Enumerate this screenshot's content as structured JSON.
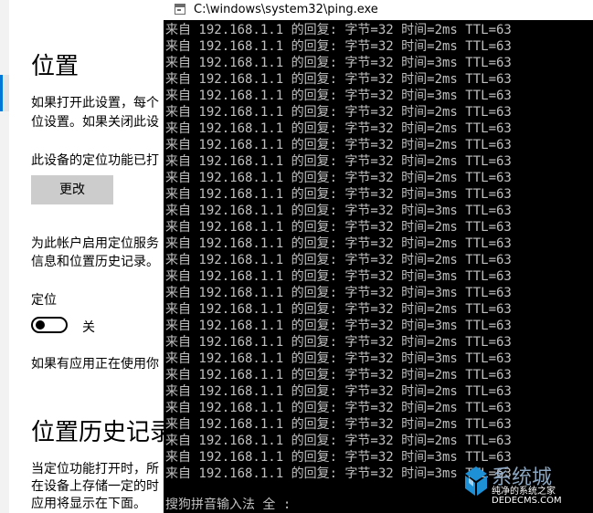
{
  "settings": {
    "title": "位置",
    "intro_line1": "如果打开此设置，每个",
    "intro_line2": "位设置。如果关闭此设",
    "device_status": "此设备的定位功能已打",
    "change_button": "更改",
    "account_line1": "为此帐户启用定位服务",
    "account_line2": "信息和位置历史记录。",
    "location_label": "定位",
    "toggle_state_label": "关",
    "apps_note": "如果有应用正在使用你",
    "history_title": "位置历史记录",
    "history_line1": "当定位功能打开时，所",
    "history_line2": "在设备上存储一定的时",
    "history_line3": "应用将显示在下面。",
    "location_toggle_on": false
  },
  "console": {
    "title": "C:\\windows\\system32\\ping.exe",
    "lines": [
      "来自 192.168.1.1 的回复: 字节=32 时间=2ms TTL=63",
      "来自 192.168.1.1 的回复: 字节=32 时间=2ms TTL=63",
      "来自 192.168.1.1 的回复: 字节=32 时间=3ms TTL=63",
      "来自 192.168.1.1 的回复: 字节=32 时间=2ms TTL=63",
      "来自 192.168.1.1 的回复: 字节=32 时间=3ms TTL=63",
      "来自 192.168.1.1 的回复: 字节=32 时间=2ms TTL=63",
      "来自 192.168.1.1 的回复: 字节=32 时间=2ms TTL=63",
      "来自 192.168.1.1 的回复: 字节=32 时间=2ms TTL=63",
      "来自 192.168.1.1 的回复: 字节=32 时间=2ms TTL=63",
      "来自 192.168.1.1 的回复: 字节=32 时间=2ms TTL=63",
      "来自 192.168.1.1 的回复: 字节=32 时间=3ms TTL=63",
      "来自 192.168.1.1 的回复: 字节=32 时间=3ms TTL=63",
      "来自 192.168.1.1 的回复: 字节=32 时间=2ms TTL=63",
      "来自 192.168.1.1 的回复: 字节=32 时间=2ms TTL=63",
      "来自 192.168.1.1 的回复: 字节=32 时间=2ms TTL=63",
      "来自 192.168.1.1 的回复: 字节=32 时间=3ms TTL=63",
      "来自 192.168.1.1 的回复: 字节=32 时间=3ms TTL=63",
      "来自 192.168.1.1 的回复: 字节=32 时间=2ms TTL=63",
      "来自 192.168.1.1 的回复: 字节=32 时间=3ms TTL=63",
      "来自 192.168.1.1 的回复: 字节=32 时间=2ms TTL=63",
      "来自 192.168.1.1 的回复: 字节=32 时间=3ms TTL=63",
      "来自 192.168.1.1 的回复: 字节=32 时间=2ms TTL=63",
      "来自 192.168.1.1 的回复: 字节=32 时间=2ms TTL=63",
      "来自 192.168.1.1 的回复: 字节=32 时间=2ms TTL=63",
      "来自 192.168.1.1 的回复: 字节=32 时间=2ms TTL=63",
      "来自 192.168.1.1 的回复: 字节=32 时间=2ms TTL=63",
      "来自 192.168.1.1 的回复: 字节=32 时间=3ms TTL=63",
      "来自 192.168.1.1 的回复: 字节=32 时间=3ms TTL=63"
    ],
    "ime_status": "搜狗拼音输入法 全 :"
  },
  "watermark": {
    "logo_text": "系统城",
    "line1": "纯净的系统之家",
    "line2": "DEDECMS.COM"
  },
  "colors": {
    "accent": "#0078d7",
    "console_bg": "#000000",
    "console_text": "#c0c0c0",
    "button_bg": "#cccccc",
    "nav_bg": "#f2f2f2"
  },
  "icons": [
    "console-app-icon",
    "windows-logo-icon"
  ]
}
